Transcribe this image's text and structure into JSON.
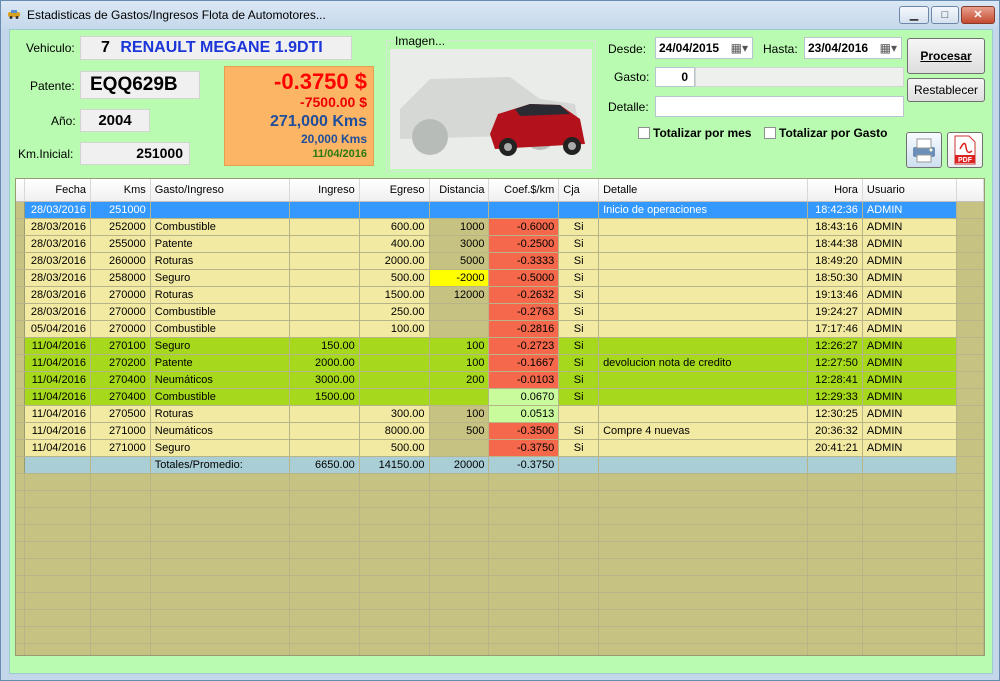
{
  "window": {
    "title": "Estadisticas de Gastos/Ingresos Flota de Automotores...",
    "min": "▁",
    "max": "□",
    "close": "✕"
  },
  "vehicle": {
    "label_vehiculo": "Vehiculo:",
    "vehiculo_num": "7",
    "vehiculo_name": "RENAULT MEGANE 1.9DTI",
    "label_patente": "Patente:",
    "patente": "EQQ629B",
    "label_anio": "Año:",
    "anio": "2004",
    "label_km": "Km.Inicial:",
    "km_inicial": "251000"
  },
  "summary": {
    "coef": "-0.3750 $",
    "total": "-7500.00 $",
    "kms": "271,000 Kms",
    "kms_diff": "20,000 Kms",
    "date": "11/04/2016"
  },
  "image": {
    "label": "Imagen..."
  },
  "filters": {
    "desde_label": "Desde:",
    "desde": "24/04/2015",
    "hasta_label": "Hasta:",
    "hasta": "23/04/2016",
    "gasto_label": "Gasto:",
    "gasto": "0",
    "detalle_label": "Detalle:",
    "detalle": "",
    "chk_mes": "Totalizar por mes",
    "chk_gasto": "Totalizar por Gasto"
  },
  "buttons": {
    "procesar": "Procesar",
    "restablecer": "Restablecer",
    "pdf": "PDF"
  },
  "colors": {
    "client_bg": "#b9fbb0",
    "grid_bg": "#c6c281",
    "summary_bg": "#fbb565",
    "coef_red": "#f00",
    "kms_blue": "#1f4e9b",
    "row_yellow": "#f2eaa2",
    "row_green": "#a6d91b",
    "neg": "#f5684b"
  },
  "table": {
    "columns": [
      "Fecha",
      "Kms",
      "Gasto/Ingreso",
      "Ingreso",
      "Egreso",
      "Distancia",
      "Coef.$/km",
      "Cja",
      "Detalle",
      "Hora",
      "Usuario"
    ],
    "rows": [
      {
        "fecha": "28/03/2016",
        "kms": "251000",
        "gasto": "",
        "ingreso": "",
        "egreso": "",
        "dist": "",
        "coef": "",
        "cja": "",
        "detalle": "Inicio de operaciones",
        "hora": "18:42:36",
        "usuario": "ADMIN",
        "style": "sel"
      },
      {
        "fecha": "28/03/2016",
        "kms": "252000",
        "gasto": "Combustible",
        "ingreso": "",
        "egreso": "600.00",
        "dist": "1000",
        "coef": "-0.6000",
        "cja": "Si",
        "detalle": "",
        "hora": "18:43:16",
        "usuario": "ADMIN",
        "style": "y"
      },
      {
        "fecha": "28/03/2016",
        "kms": "255000",
        "gasto": "Patente",
        "ingreso": "",
        "egreso": "400.00",
        "dist": "3000",
        "coef": "-0.2500",
        "cja": "Si",
        "detalle": "",
        "hora": "18:44:38",
        "usuario": "ADMIN",
        "style": "y"
      },
      {
        "fecha": "28/03/2016",
        "kms": "260000",
        "gasto": "Roturas",
        "ingreso": "",
        "egreso": "2000.00",
        "dist": "5000",
        "coef": "-0.3333",
        "cja": "Si",
        "detalle": "",
        "hora": "18:49:20",
        "usuario": "ADMIN",
        "style": "y"
      },
      {
        "fecha": "28/03/2016",
        "kms": "258000",
        "gasto": "Seguro",
        "ingreso": "",
        "egreso": "500.00",
        "dist": "-2000",
        "coef": "-0.5000",
        "cja": "Si",
        "detalle": "",
        "hora": "18:50:30",
        "usuario": "ADMIN",
        "style": "y",
        "distYellow": true
      },
      {
        "fecha": "28/03/2016",
        "kms": "270000",
        "gasto": "Roturas",
        "ingreso": "",
        "egreso": "1500.00",
        "dist": "12000",
        "coef": "-0.2632",
        "cja": "Si",
        "detalle": "",
        "hora": "19:13:46",
        "usuario": "ADMIN",
        "style": "y"
      },
      {
        "fecha": "28/03/2016",
        "kms": "270000",
        "gasto": "Combustible",
        "ingreso": "",
        "egreso": "250.00",
        "dist": "",
        "coef": "-0.2763",
        "cja": "Si",
        "detalle": "",
        "hora": "19:24:27",
        "usuario": "ADMIN",
        "style": "y"
      },
      {
        "fecha": "05/04/2016",
        "kms": "270000",
        "gasto": "Combustible",
        "ingreso": "",
        "egreso": "100.00",
        "dist": "",
        "coef": "-0.2816",
        "cja": "Si",
        "detalle": "",
        "hora": "17:17:46",
        "usuario": "ADMIN",
        "style": "y"
      },
      {
        "fecha": "11/04/2016",
        "kms": "270100",
        "gasto": "Seguro",
        "ingreso": "150.00",
        "egreso": "",
        "dist": "100",
        "coef": "-0.2723",
        "cja": "Si",
        "detalle": "",
        "hora": "12:26:27",
        "usuario": "ADMIN",
        "style": "g"
      },
      {
        "fecha": "11/04/2016",
        "kms": "270200",
        "gasto": "Patente",
        "ingreso": "2000.00",
        "egreso": "",
        "dist": "100",
        "coef": "-0.1667",
        "cja": "Si",
        "detalle": "devolucion nota de credito",
        "hora": "12:27:50",
        "usuario": "ADMIN",
        "style": "g"
      },
      {
        "fecha": "11/04/2016",
        "kms": "270400",
        "gasto": "Neumáticos",
        "ingreso": "3000.00",
        "egreso": "",
        "dist": "200",
        "coef": "-0.0103",
        "cja": "Si",
        "detalle": "",
        "hora": "12:28:41",
        "usuario": "ADMIN",
        "style": "g"
      },
      {
        "fecha": "11/04/2016",
        "kms": "270400",
        "gasto": "Combustible",
        "ingreso": "1500.00",
        "egreso": "",
        "dist": "",
        "coef": "0.0670",
        "cja": "Si",
        "detalle": "",
        "hora": "12:29:33",
        "usuario": "ADMIN",
        "style": "g",
        "coefPos": true
      },
      {
        "fecha": "11/04/2016",
        "kms": "270500",
        "gasto": "Roturas",
        "ingreso": "",
        "egreso": "300.00",
        "dist": "100",
        "coef": "0.0513",
        "cja": "",
        "detalle": "",
        "hora": "12:30:25",
        "usuario": "ADMIN",
        "style": "y",
        "coefPos": true
      },
      {
        "fecha": "11/04/2016",
        "kms": "271000",
        "gasto": "Neumáticos",
        "ingreso": "",
        "egreso": "8000.00",
        "dist": "500",
        "coef": "-0.3500",
        "cja": "Si",
        "detalle": "Compre 4 nuevas",
        "hora": "20:36:32",
        "usuario": "ADMIN",
        "style": "y"
      },
      {
        "fecha": "11/04/2016",
        "kms": "271000",
        "gasto": "Seguro",
        "ingreso": "",
        "egreso": "500.00",
        "dist": "",
        "coef": "-0.3750",
        "cja": "Si",
        "detalle": "",
        "hora": "20:41:21",
        "usuario": "ADMIN",
        "style": "y"
      }
    ],
    "totals": {
      "label": "Totales/Promedio:",
      "ingreso": "6650.00",
      "egreso": "14150.00",
      "dist": "20000",
      "coef": "-0.3750"
    }
  }
}
